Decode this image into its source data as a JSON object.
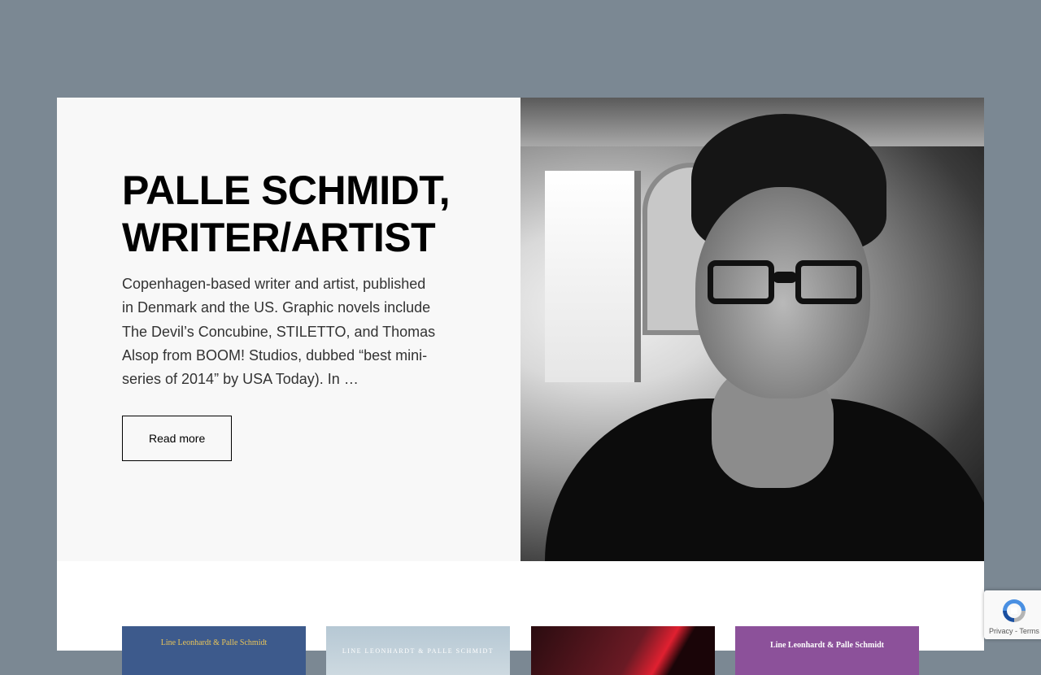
{
  "hero": {
    "title_line1": "PALLE SCHMIDT,",
    "title_line2": "WRITER/ARTIST",
    "description": "Copenhagen-based writer and artist, published in Denmark and the US. Graphic novels include The Devil’s Concubine, STILETTO, and Thomas Alsop from BOOM! Studios, dubbed “best mini-series of 2014” by USA Today). In …",
    "read_more_label": "Read more"
  },
  "books": [
    {
      "cover_text": "Line Leonhardt & Palle Schmidt",
      "color": "#3d5a8c"
    },
    {
      "cover_text": "LINE LEONHARDT & PALLE SCHMIDT",
      "color": "#c4d3dc"
    },
    {
      "cover_text": "",
      "color": "#6a1a24"
    },
    {
      "cover_text": "Line Leonhardt & Palle Schmidt",
      "color": "#8c519a"
    }
  ],
  "recaptcha": {
    "privacy_label": "Privacy",
    "separator": "-",
    "terms_label": "Terms"
  },
  "colors": {
    "page_background": "#7b8893",
    "hero_text_background": "#f8f8f8",
    "recaptcha_blue": "#4a90e2"
  }
}
